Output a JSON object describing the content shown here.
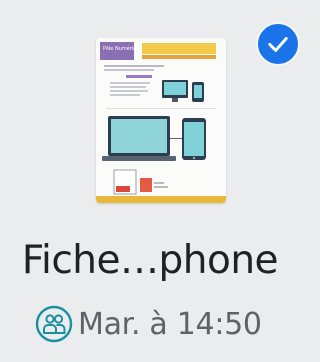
{
  "file": {
    "name": "Fiche…phone",
    "modified": "Mar. à 14:50",
    "selected": true
  },
  "thumbnail": {
    "header_text_left": "Pôle Numérique"
  },
  "icons": {
    "selection": "check-circle-icon",
    "sharing": "shared-people-icon"
  },
  "colors": {
    "accent": "#1a73e8",
    "shared_icon": "#1a8fa0",
    "background": "#ebeced"
  }
}
